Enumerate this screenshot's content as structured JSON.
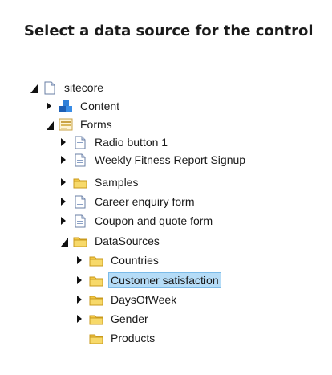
{
  "dialog": {
    "title": "Select a data source for the control"
  },
  "tree": {
    "root": {
      "label": "sitecore",
      "icon": "page-icon"
    },
    "content": {
      "label": "Content",
      "icon": "content-cubes-icon"
    },
    "forms": {
      "label": "Forms",
      "icon": "form-icon"
    },
    "radio_button_1": {
      "label": "Radio button 1",
      "icon": "page-icon"
    },
    "weekly_fitness": {
      "label": "Weekly Fitness Report Signup",
      "icon": "page-icon"
    },
    "samples": {
      "label": "Samples",
      "icon": "folder-icon"
    },
    "career_enquiry": {
      "label": "Career enquiry form",
      "icon": "page-icon"
    },
    "coupon_quote": {
      "label": "Coupon and quote form",
      "icon": "page-icon"
    },
    "datasources": {
      "label": "DataSources",
      "icon": "folder-icon"
    },
    "countries": {
      "label": "Countries",
      "icon": "folder-icon"
    },
    "customer_satisfaction": {
      "label": "Customer satisfaction",
      "icon": "folder-icon",
      "selected": true
    },
    "days_of_week": {
      "label": "DaysOfWeek",
      "icon": "folder-icon"
    },
    "gender": {
      "label": "Gender",
      "icon": "folder-icon"
    },
    "products": {
      "label": "Products",
      "icon": "folder-icon"
    }
  },
  "colors": {
    "selection_bg": "#b5dcf7",
    "selection_border": "#7cbbe8",
    "folder": "#f2c744"
  }
}
